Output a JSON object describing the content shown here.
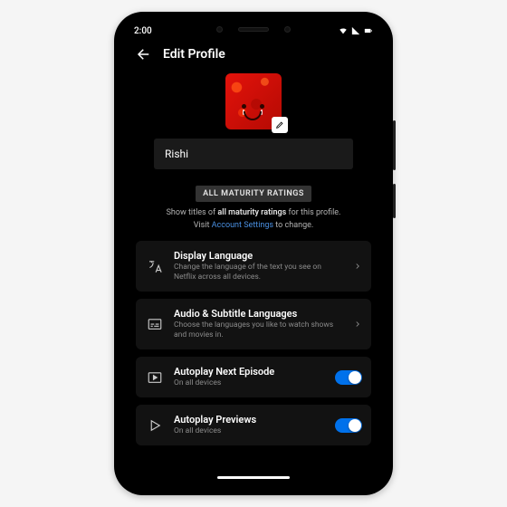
{
  "status": {
    "time": "2:00"
  },
  "header": {
    "title": "Edit Profile"
  },
  "profile": {
    "name": "Rishi"
  },
  "maturity": {
    "badge": "ALL MATURITY RATINGS",
    "line1a": "Show titles of ",
    "line1b": "all maturity ratings",
    "line1c": " for this profile.",
    "line2a": "Visit ",
    "link": "Account Settings",
    "line2b": " to change."
  },
  "settings": {
    "display_language": {
      "title": "Display Language",
      "subtitle": "Change the language of the text you see on Netflix across all devices."
    },
    "audio_subtitle": {
      "title": "Audio & Subtitle Languages",
      "subtitle": "Choose the languages you like to watch shows and movies in."
    },
    "autoplay_next": {
      "title": "Autoplay Next Episode",
      "subtitle": "On all devices",
      "enabled": true
    },
    "autoplay_previews": {
      "title": "Autoplay Previews",
      "subtitle": "On all devices",
      "enabled": true
    }
  }
}
